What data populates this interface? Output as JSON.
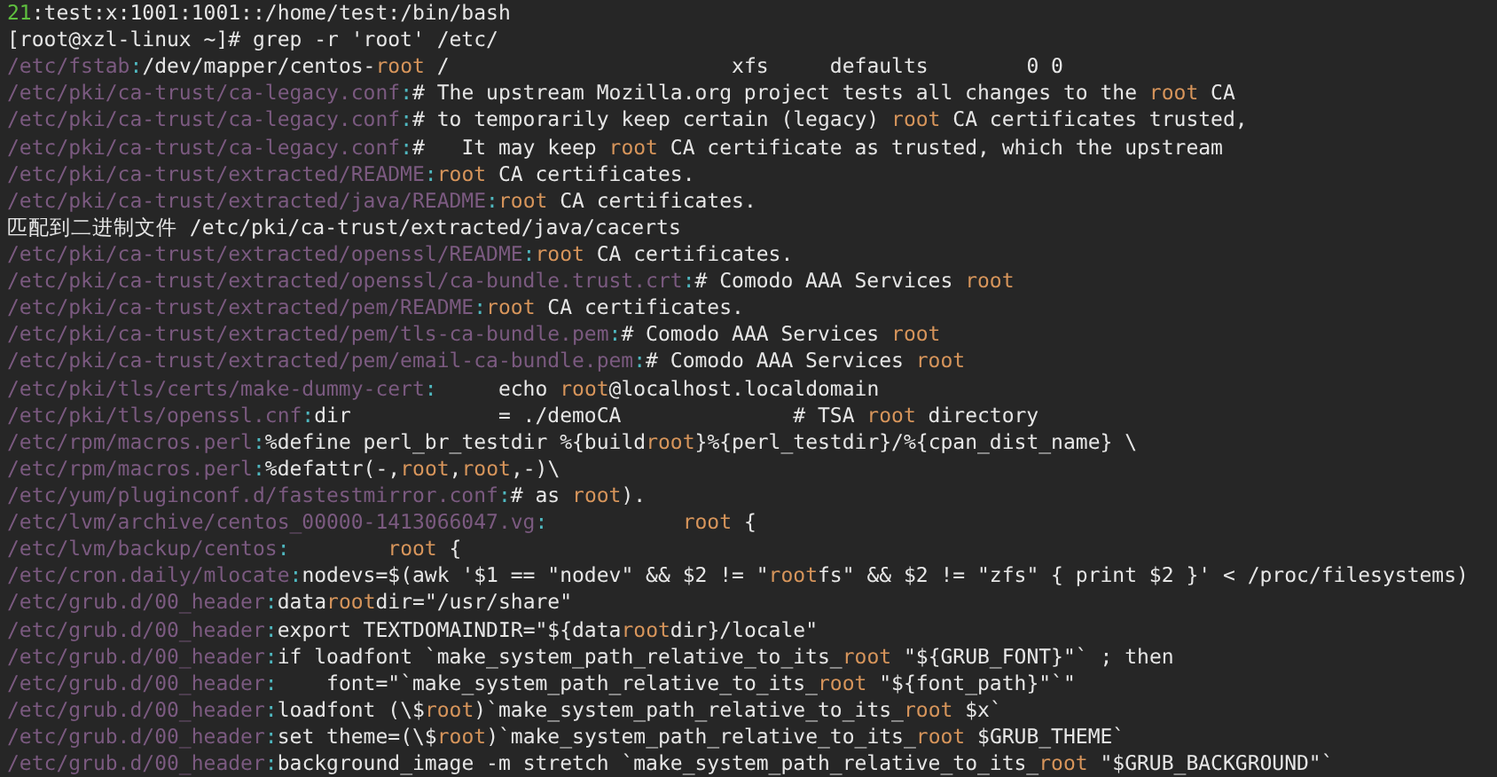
{
  "terminal": {
    "lines": [
      {
        "kind": "previous",
        "number": "21",
        "text": ":test:x:1001:1001::/home/test:/bin/bash"
      },
      {
        "kind": "prompt",
        "text": "[root@xzl-linux ~]# grep -r 'root' /etc/"
      },
      {
        "kind": "match",
        "file": "/etc/fstab",
        "separator": ":",
        "parts": [
          {
            "text": "/dev/mapper/centos-",
            "match": false
          },
          {
            "text": "root",
            "match": true
          },
          {
            "text": " /                       xfs     defaults        0 0",
            "match": false
          }
        ]
      },
      {
        "kind": "match",
        "file": "/etc/pki/ca-trust/ca-legacy.conf",
        "separator": ":",
        "parts": [
          {
            "text": "# The upstream Mozilla.org project tests all changes to the ",
            "match": false
          },
          {
            "text": "root",
            "match": true
          },
          {
            "text": " CA",
            "match": false
          }
        ]
      },
      {
        "kind": "match",
        "file": "/etc/pki/ca-trust/ca-legacy.conf",
        "separator": ":",
        "parts": [
          {
            "text": "# to temporarily keep certain (legacy) ",
            "match": false
          },
          {
            "text": "root",
            "match": true
          },
          {
            "text": " CA certificates trusted,",
            "match": false
          }
        ]
      },
      {
        "kind": "match",
        "file": "/etc/pki/ca-trust/ca-legacy.conf",
        "separator": ":",
        "parts": [
          {
            "text": "#   It may keep ",
            "match": false
          },
          {
            "text": "root",
            "match": true
          },
          {
            "text": " CA certificate as trusted, which the upstream",
            "match": false
          }
        ]
      },
      {
        "kind": "match",
        "file": "/etc/pki/ca-trust/extracted/README",
        "separator": ":",
        "parts": [
          {
            "text": "root",
            "match": true
          },
          {
            "text": " CA certificates.",
            "match": false
          }
        ]
      },
      {
        "kind": "match",
        "file": "/etc/pki/ca-trust/extracted/java/README",
        "separator": ":",
        "parts": [
          {
            "text": "root",
            "match": true
          },
          {
            "text": " CA certificates.",
            "match": false
          }
        ]
      },
      {
        "kind": "plain",
        "text": "匹配到二进制文件 /etc/pki/ca-trust/extracted/java/cacerts"
      },
      {
        "kind": "match",
        "file": "/etc/pki/ca-trust/extracted/openssl/README",
        "separator": ":",
        "parts": [
          {
            "text": "root",
            "match": true
          },
          {
            "text": " CA certificates.",
            "match": false
          }
        ]
      },
      {
        "kind": "match",
        "file": "/etc/pki/ca-trust/extracted/openssl/ca-bundle.trust.crt",
        "separator": ":",
        "parts": [
          {
            "text": "# Comodo AAA Services ",
            "match": false
          },
          {
            "text": "root",
            "match": true
          }
        ]
      },
      {
        "kind": "match",
        "file": "/etc/pki/ca-trust/extracted/pem/README",
        "separator": ":",
        "parts": [
          {
            "text": "root",
            "match": true
          },
          {
            "text": " CA certificates.",
            "match": false
          }
        ]
      },
      {
        "kind": "match",
        "file": "/etc/pki/ca-trust/extracted/pem/tls-ca-bundle.pem",
        "separator": ":",
        "parts": [
          {
            "text": "# Comodo AAA Services ",
            "match": false
          },
          {
            "text": "root",
            "match": true
          }
        ]
      },
      {
        "kind": "match",
        "file": "/etc/pki/ca-trust/extracted/pem/email-ca-bundle.pem",
        "separator": ":",
        "parts": [
          {
            "text": "# Comodo AAA Services ",
            "match": false
          },
          {
            "text": "root",
            "match": true
          }
        ]
      },
      {
        "kind": "match",
        "file": "/etc/pki/tls/certs/make-dummy-cert",
        "separator": ":",
        "parts": [
          {
            "text": "     echo ",
            "match": false
          },
          {
            "text": "root",
            "match": true
          },
          {
            "text": "@localhost.localdomain",
            "match": false
          }
        ]
      },
      {
        "kind": "match",
        "file": "/etc/pki/tls/openssl.cnf",
        "separator": ":",
        "parts": [
          {
            "text": "dir            = ./demoCA              # TSA ",
            "match": false
          },
          {
            "text": "root",
            "match": true
          },
          {
            "text": " directory",
            "match": false
          }
        ]
      },
      {
        "kind": "match",
        "file": "/etc/rpm/macros.perl",
        "separator": ":",
        "parts": [
          {
            "text": "%define perl_br_testdir %{build",
            "match": false
          },
          {
            "text": "root",
            "match": true
          },
          {
            "text": "}%{perl_testdir}/%{cpan_dist_name} \\",
            "match": false
          }
        ]
      },
      {
        "kind": "match",
        "file": "/etc/rpm/macros.perl",
        "separator": ":",
        "parts": [
          {
            "text": "%defattr(-,",
            "match": false
          },
          {
            "text": "root",
            "match": true
          },
          {
            "text": ",",
            "match": false
          },
          {
            "text": "root",
            "match": true
          },
          {
            "text": ",-)\\",
            "match": false
          }
        ]
      },
      {
        "kind": "match",
        "file": "/etc/yum/pluginconf.d/fastestmirror.conf",
        "separator": ":",
        "parts": [
          {
            "text": "# as ",
            "match": false
          },
          {
            "text": "root",
            "match": true
          },
          {
            "text": ").",
            "match": false
          }
        ]
      },
      {
        "kind": "match",
        "file": "/etc/lvm/archive/centos_00000-1413066047.vg",
        "separator": ":           ",
        "parts": [
          {
            "text": "root",
            "match": true
          },
          {
            "text": " {",
            "match": false
          }
        ]
      },
      {
        "kind": "match",
        "file": "/etc/lvm/backup/centos",
        "separator": ":        ",
        "parts": [
          {
            "text": "root",
            "match": true
          },
          {
            "text": " {",
            "match": false
          }
        ]
      },
      {
        "kind": "match",
        "file": "/etc/cron.daily/mlocate",
        "separator": ":",
        "parts": [
          {
            "text": "nodevs=$(awk '$1 == \"nodev\" && $2 != \"",
            "match": false
          },
          {
            "text": "root",
            "match": true
          },
          {
            "text": "fs\" && $2 != \"zfs\" { print $2 }' < /proc/filesystems)",
            "match": false
          }
        ]
      },
      {
        "kind": "match",
        "file": "/etc/grub.d/00_header",
        "separator": ":",
        "parts": [
          {
            "text": "data",
            "match": false
          },
          {
            "text": "root",
            "match": true
          },
          {
            "text": "dir=\"/usr/share\"",
            "match": false
          }
        ]
      },
      {
        "kind": "match",
        "file": "/etc/grub.d/00_header",
        "separator": ":",
        "parts": [
          {
            "text": "export TEXTDOMAINDIR=\"${data",
            "match": false
          },
          {
            "text": "root",
            "match": true
          },
          {
            "text": "dir}/locale\"",
            "match": false
          }
        ]
      },
      {
        "kind": "match",
        "file": "/etc/grub.d/00_header",
        "separator": ":",
        "parts": [
          {
            "text": "if loadfont `make_system_path_relative_to_its_",
            "match": false
          },
          {
            "text": "root",
            "match": true
          },
          {
            "text": " \"${GRUB_FONT}\"` ; then",
            "match": false
          }
        ]
      },
      {
        "kind": "match",
        "file": "/etc/grub.d/00_header",
        "separator": ":",
        "parts": [
          {
            "text": "    font=\"`make_system_path_relative_to_its_",
            "match": false
          },
          {
            "text": "root",
            "match": true
          },
          {
            "text": " \"${font_path}\"`\"",
            "match": false
          }
        ]
      },
      {
        "kind": "match",
        "file": "/etc/grub.d/00_header",
        "separator": ":",
        "parts": [
          {
            "text": "loadfont (\\$",
            "match": false
          },
          {
            "text": "root",
            "match": true
          },
          {
            "text": ")`make_system_path_relative_to_its_",
            "match": false
          },
          {
            "text": "root",
            "match": true
          },
          {
            "text": " $x`",
            "match": false
          }
        ]
      },
      {
        "kind": "match",
        "file": "/etc/grub.d/00_header",
        "separator": ":",
        "parts": [
          {
            "text": "set theme=(\\$",
            "match": false
          },
          {
            "text": "root",
            "match": true
          },
          {
            "text": ")`make_system_path_relative_to_its_",
            "match": false
          },
          {
            "text": "root",
            "match": true
          },
          {
            "text": " $GRUB_THEME`",
            "match": false
          }
        ]
      },
      {
        "kind": "match",
        "file": "/etc/grub.d/00_header",
        "separator": ":",
        "parts": [
          {
            "text": "background_image -m stretch `make_system_path_relative_to_its_",
            "match": false
          },
          {
            "text": "root",
            "match": true
          },
          {
            "text": " \"$GRUB_BACKGROUND\"`",
            "match": false
          }
        ]
      }
    ]
  }
}
